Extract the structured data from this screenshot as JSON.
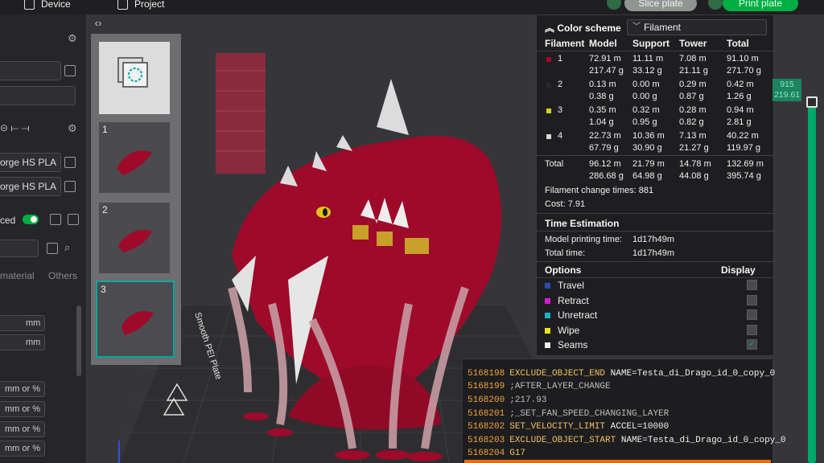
{
  "topbar": {
    "device_label": "Device",
    "project_label": "Project",
    "slice_label": "Slice plate",
    "print_label": "Print plate"
  },
  "left_panel": {
    "filament_1": "orge HS PLA",
    "filament_2": "orge HS PLA",
    "mode_label": "ced",
    "tabs": [
      "material",
      "Others"
    ],
    "units": [
      "mm",
      "mm",
      "mm or %",
      "mm or %",
      "mm or %",
      "mm or %"
    ]
  },
  "plates": [
    {
      "num": "1"
    },
    {
      "num": "2"
    },
    {
      "num": "3"
    }
  ],
  "color_scheme": {
    "title": "Color scheme",
    "selected": "Filament",
    "columns": [
      "Filament",
      "Model",
      "Support",
      "Tower",
      "Total"
    ],
    "rows": [
      {
        "id": "1",
        "color": "#9e0a2a",
        "model": [
          "72.91 m",
          "217.47 g"
        ],
        "support": [
          "11.11 m",
          "33.12 g"
        ],
        "tower": [
          "7.08 m",
          "21.11 g"
        ],
        "total": [
          "91.10 m",
          "271.70 g"
        ]
      },
      {
        "id": "2",
        "color": "#2a2a2a",
        "model": [
          "0.13 m",
          "0.38 g"
        ],
        "support": [
          "0.00 m",
          "0.00 g"
        ],
        "tower": [
          "0.29 m",
          "0.87 g"
        ],
        "total": [
          "0.42 m",
          "1.26 g"
        ]
      },
      {
        "id": "3",
        "color": "#d9d21c",
        "model": [
          "0.35 m",
          "1.04 g"
        ],
        "support": [
          "0.32 m",
          "0.95 g"
        ],
        "tower": [
          "0.28 m",
          "0.82 g"
        ],
        "total": [
          "0.94 m",
          "2.81 g"
        ]
      },
      {
        "id": "4",
        "color": "#d8d8d8",
        "model": [
          "22.73 m",
          "67.79 g"
        ],
        "support": [
          "10.36 m",
          "30.90 g"
        ],
        "tower": [
          "7.13 m",
          "21.27 g"
        ],
        "total": [
          "40.22 m",
          "119.97 g"
        ]
      }
    ],
    "total_row": {
      "label": "Total",
      "model": [
        "96.12 m",
        "286.68 g"
      ],
      "support": [
        "21.79 m",
        "64.98 g"
      ],
      "tower": [
        "14.78 m",
        "44.08 g"
      ],
      "total": [
        "132.69 m",
        "395.74 g"
      ]
    },
    "filament_change": "Filament change times:  881",
    "cost": "Cost:  7.91",
    "time_estimation": {
      "title": "Time Estimation",
      "model_printing_label": "Model printing time:",
      "model_printing_value": "1d17h49m",
      "total_label": "Total time:",
      "total_value": "1d17h49m"
    },
    "options": {
      "title": "Options",
      "display_label": "Display",
      "items": [
        {
          "label": "Travel",
          "color": "#2c4aa8",
          "checked": false
        },
        {
          "label": "Retract",
          "color": "#d61ad6",
          "checked": false
        },
        {
          "label": "Unretract",
          "color": "#1ab3cc",
          "checked": false
        },
        {
          "label": "Wipe",
          "color": "#e8e21a",
          "checked": false
        },
        {
          "label": "Seams",
          "color": "#eeeeee",
          "checked": true
        }
      ]
    }
  },
  "slider": {
    "top_value": "915",
    "bottom_value": "219.61"
  },
  "gcode": [
    {
      "num": "5168198",
      "text": "EXCLUDE_OBJECT_END NAME=Testa_di_Drago_id_0_copy_0",
      "type": "instruction",
      "kw": "EXCLUDE_OBJECT_END",
      "rest": " NAME=Testa_di_Drago_id_0_copy_0"
    },
    {
      "num": "5168199",
      "text": ";AFTER_LAYER_CHANGE",
      "type": "comment"
    },
    {
      "num": "5168200",
      "text": ";217.93",
      "type": "comment"
    },
    {
      "num": "5168201",
      "text": ";_SET_FAN_SPEED_CHANGING_LAYER",
      "type": "comment"
    },
    {
      "num": "5168202",
      "text": "SET_VELOCITY_LIMIT ACCEL=10000",
      "type": "instruction",
      "kw": "SET_VELOCITY_LIMIT",
      "rest": " ACCEL=10000"
    },
    {
      "num": "5168203",
      "text": "EXCLUDE_OBJECT_START NAME=Testa_di_Drago_id_0_copy_0",
      "type": "instruction",
      "kw": "EXCLUDE_OBJECT_START",
      "rest": " NAME=Testa_di_Drago_id_0_copy_0"
    },
    {
      "num": "5168204",
      "text": "G17",
      "type": "instruction",
      "kw": "G17",
      "rest": ""
    }
  ],
  "colors": {
    "accent": "#00ae42",
    "model_red": "#9e0a2a",
    "support_white": "#e6e6e6"
  },
  "viewport": {
    "plate_label": "Smooth PEI Plate"
  }
}
